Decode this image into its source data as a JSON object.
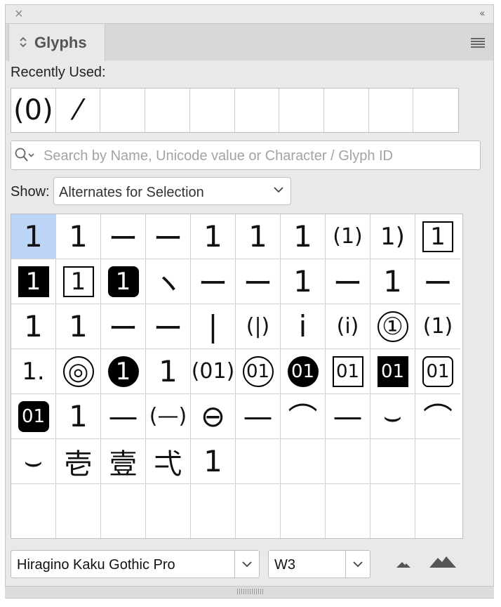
{
  "panel": {
    "close_icon": "×",
    "collapse_icon": "‹‹",
    "tab_label": "Glyphs"
  },
  "recent": {
    "label": "Recently Used:",
    "glyphs": [
      "(0)",
      "⁄",
      "",
      "",
      "",
      "",
      "",
      "",
      "",
      ""
    ]
  },
  "search": {
    "placeholder": "Search by Name, Unicode value or Character / Glyph ID"
  },
  "show": {
    "label": "Show:",
    "value": "Alternates for Selection"
  },
  "glyphs": [
    [
      "1",
      "1",
      "ー",
      "ー",
      "1",
      "1",
      "1",
      "(1)",
      "1)",
      "1"
    ],
    [
      "1",
      "1",
      "1",
      "ヽ",
      "ー",
      "ー",
      "1",
      "ー",
      "1",
      "ー"
    ],
    [
      "1",
      "1",
      "ー",
      "ー",
      "|",
      "(|)",
      "i",
      "(i)",
      "①",
      "(1)"
    ],
    [
      "1.",
      "◎",
      "1",
      "1",
      "(01)",
      "01",
      "01",
      "01",
      "01",
      "01"
    ],
    [
      "01",
      "1",
      "—",
      "(—)",
      "⊖",
      "—",
      "⌒",
      "—",
      "⌣",
      "⌒"
    ],
    [
      "⌣",
      "壱",
      "壹",
      "弌",
      "1",
      "",
      "",
      "",
      "",
      ""
    ],
    [
      "",
      "",
      "",
      "",
      "",
      "",
      "",
      "",
      "",
      ""
    ]
  ],
  "font": {
    "family": "Hiragino Kaku Gothic Pro",
    "weight": "W3"
  },
  "icons": {
    "zoom_out": "zoom-out-mountain-icon",
    "zoom_in": "zoom-in-mountain-icon",
    "search": "search-icon",
    "menu": "hamburger-menu-icon"
  }
}
